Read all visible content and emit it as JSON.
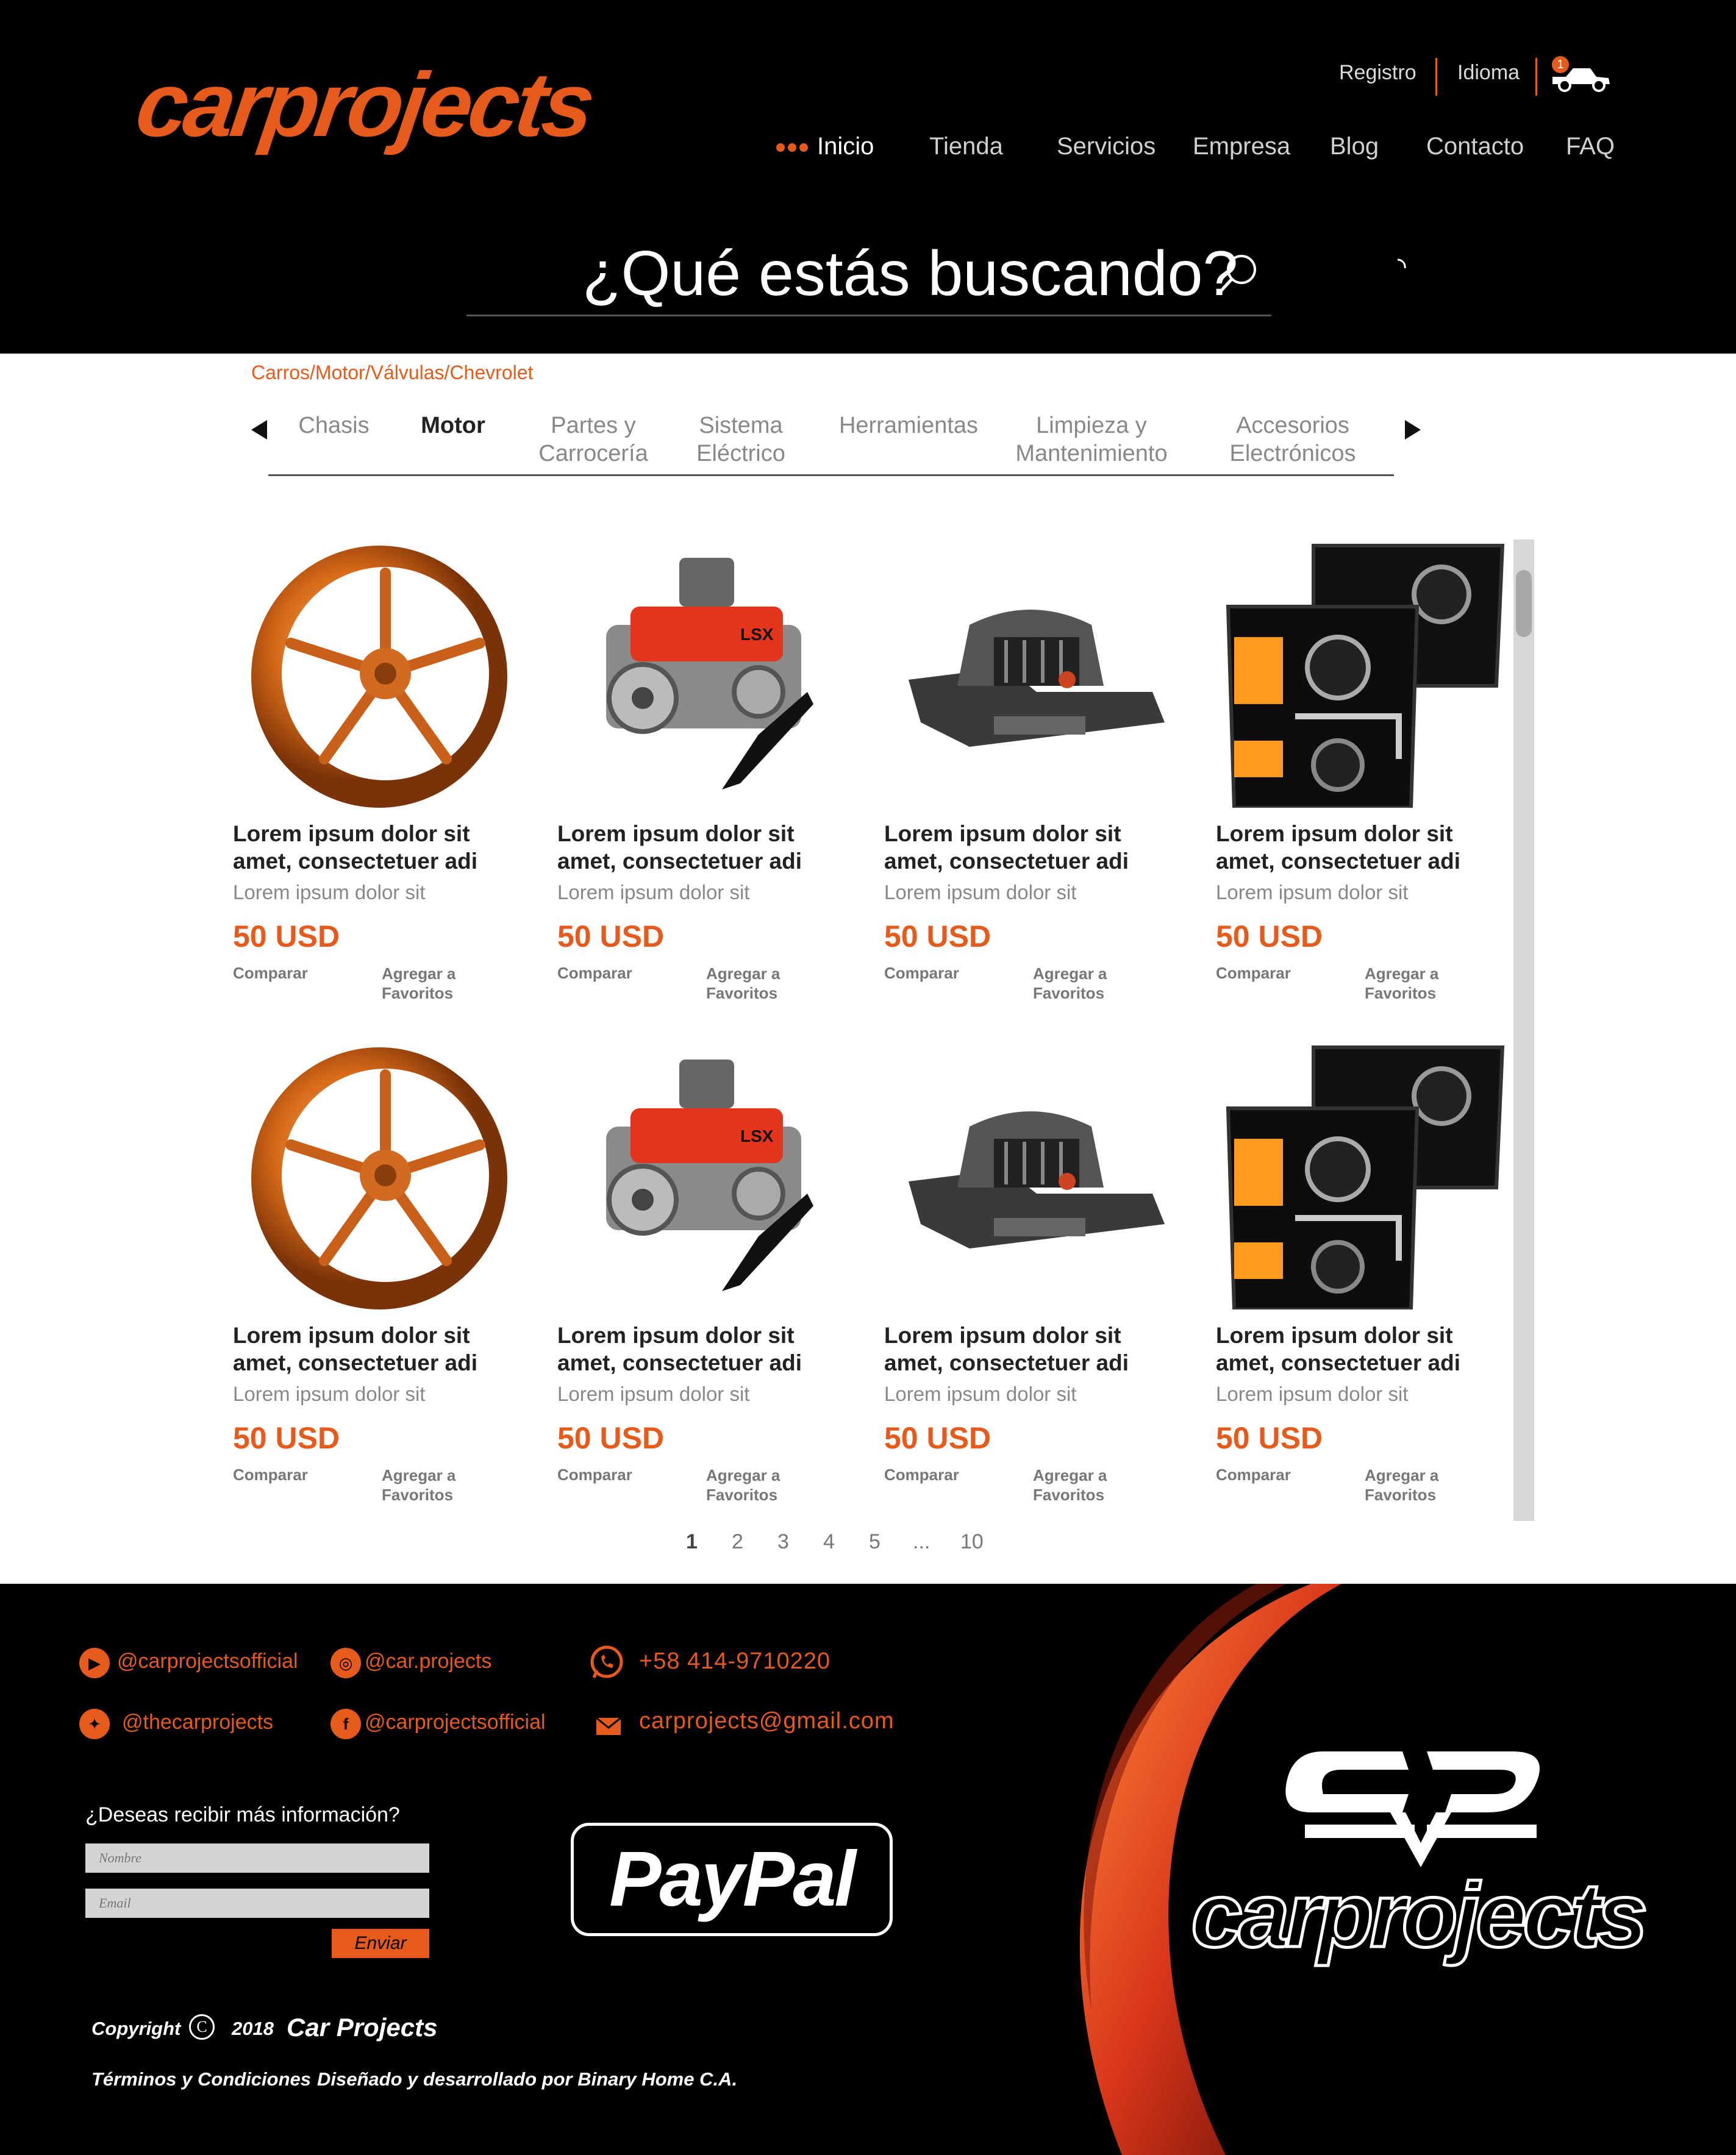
{
  "header": {
    "logo_text": "carprojects",
    "top_links": [
      "Registro",
      "Idioma"
    ],
    "cart_count": "1",
    "nav": [
      "Inicio",
      "Tienda",
      "Servicios",
      "Empresa",
      "Blog",
      "Contacto",
      "FAQ"
    ],
    "search_placeholder": "¿Qué estás buscando?"
  },
  "breadcrumb": "Carros/Motor/Válvulas/Chevrolet",
  "categories": [
    {
      "line1": "Chasis",
      "line2": ""
    },
    {
      "line1": "Motor",
      "line2": ""
    },
    {
      "line1": "Partes y",
      "line2": "Carrocería"
    },
    {
      "line1": "Sistema",
      "line2": "Eléctrico"
    },
    {
      "line1": "Herramientas",
      "line2": ""
    },
    {
      "line1": "Limpieza y",
      "line2": "Mantenimiento"
    },
    {
      "line1": "Accesorios",
      "line2": "Electrónicos"
    }
  ],
  "product_labels": {
    "title_line1": "Lorem ipsum dolor sit",
    "title_line2": "amet, consectetuer adi",
    "subtitle": "Lorem ipsum dolor sit",
    "price": "50 USD",
    "compare": "Comparar",
    "favorite_line1": "Agregar a",
    "favorite_line2": "Favoritos"
  },
  "product_images": [
    "wheel-image",
    "engine-image",
    "bumper-image",
    "headlight-image",
    "wheel-image",
    "engine-image",
    "bumper-image",
    "headlight-image"
  ],
  "pagination": [
    "1",
    "2",
    "3",
    "4",
    "5",
    "...",
    "10"
  ],
  "footer": {
    "youtube": "@carprojectsofficial",
    "instagram": "@car.projects",
    "twitter": "@thecarprojects",
    "facebook": "@carprojectsofficial",
    "phone": "+58 414-9710220",
    "email": "carprojects@gmail.com",
    "newsletter_label": "¿Deseas recibir más información?",
    "name_placeholder": "Nombre",
    "email_placeholder": "Email",
    "send_label": "Enviar",
    "paypal": "PayPal",
    "logo_text": "carprojects",
    "copyright_word": "Copyright",
    "copyright_symbol": "C",
    "year": "2018",
    "company": "Car Projects",
    "terms": "Términos y Condiciones",
    "credits": "Diseñado y desarrollado por Binary Home C.A."
  },
  "colors": {
    "accent": "#e65a1c",
    "header_bg": "#000000",
    "main_bg": "#ffffff"
  }
}
